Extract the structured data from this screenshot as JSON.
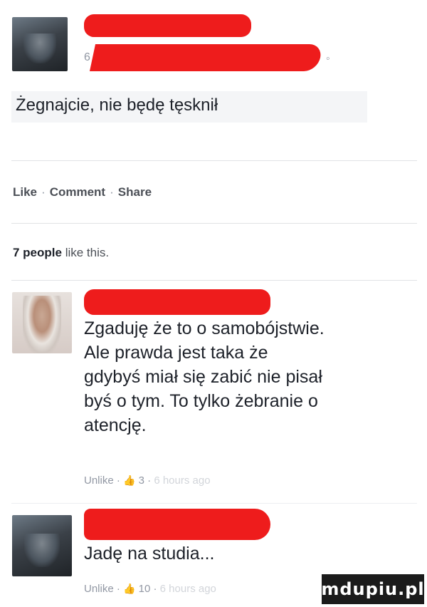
{
  "post": {
    "text": "Żegnajcie, nie będę tęsknił",
    "meta_fragment_left": "6",
    "meta_fragment_right": "◦"
  },
  "actions": {
    "like": "Like",
    "comment": "Comment",
    "share": "Share",
    "separator": "·"
  },
  "likes": {
    "count": "7 people",
    "suffix": " like this."
  },
  "comments": [
    {
      "text": "Zgaduję że to o samobójstwie. Ale prawda jest taka że gdybyś miał się zabić nie pisał byś o tym. To tylko żebranie o atencję.",
      "lines": [
        "Zgaduję że to o samobójstwie.",
        "Ale prawda jest taka że",
        "gdybyś miał się zabić nie pisał",
        "byś o tym. To tylko żebranie o",
        "atencję."
      ],
      "unlike": "Unlike",
      "like_count": "3",
      "time": "6 hours ago"
    },
    {
      "text": "Jadę na studia...",
      "unlike": "Unlike",
      "like_count": "10",
      "time": "6 hours ago"
    }
  ],
  "icons": {
    "thumb": "thumbs-up-icon"
  },
  "colors": {
    "redaction": "#ee1c1c",
    "meta": "#9197a3",
    "link_blue": "#5b7bd5"
  },
  "watermark": "mdupiu.pl"
}
